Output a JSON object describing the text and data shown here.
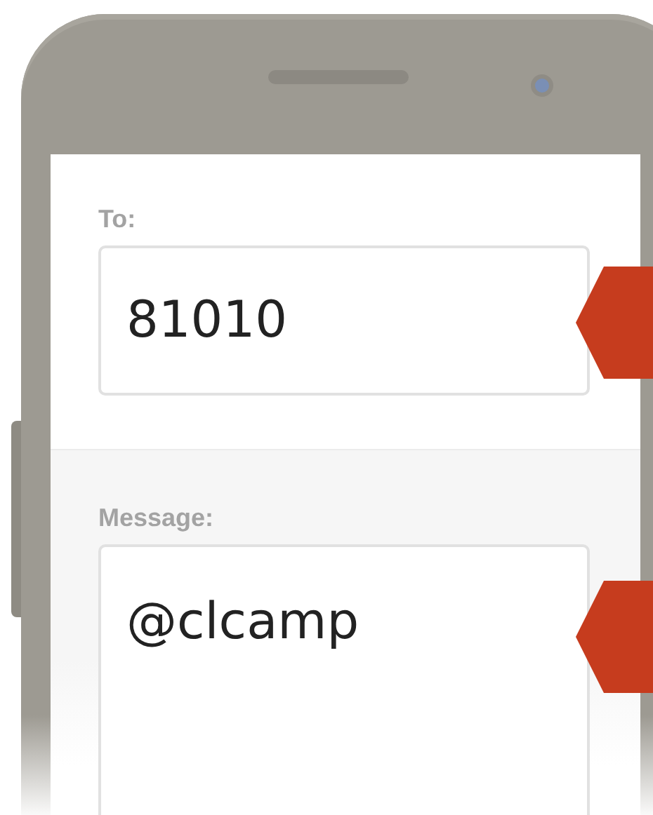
{
  "compose": {
    "to": {
      "label": "To:",
      "value": "81010"
    },
    "message": {
      "label": "Message:",
      "value": "@clcamp"
    }
  }
}
